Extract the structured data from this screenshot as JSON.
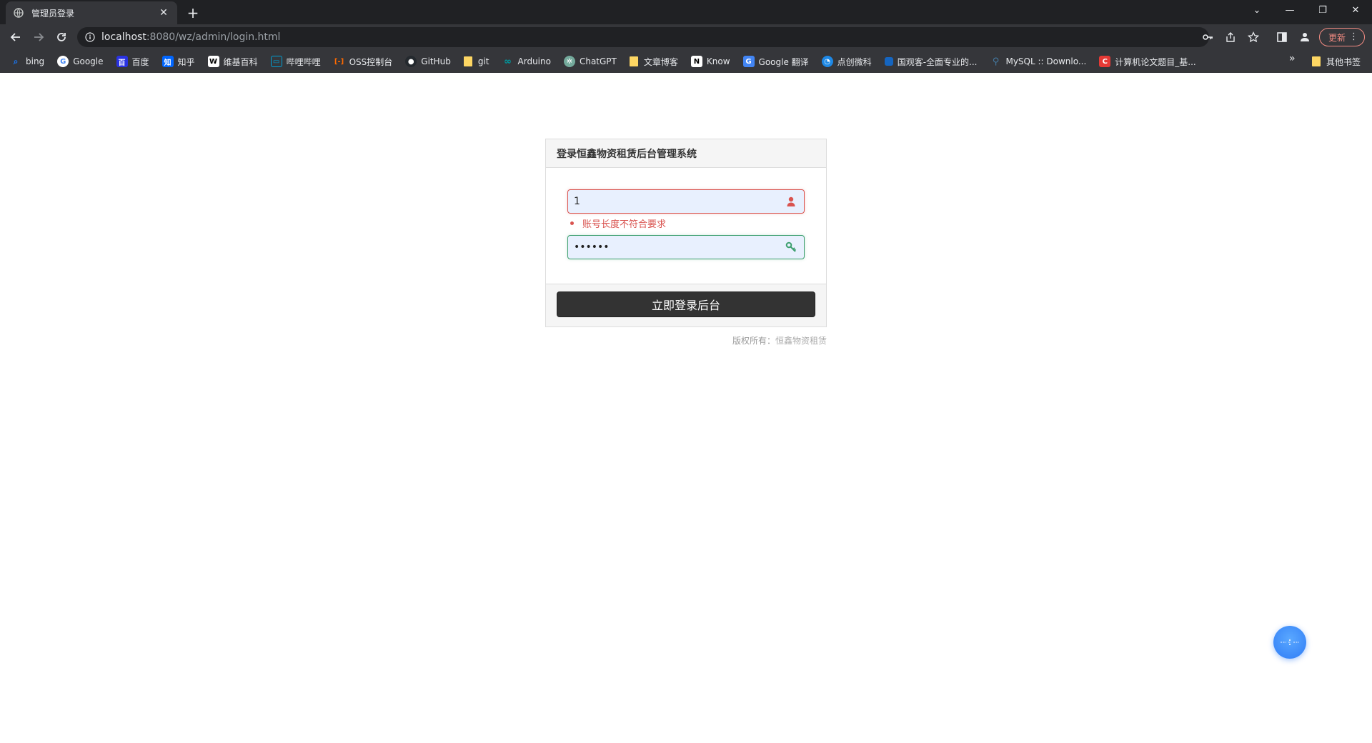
{
  "browser": {
    "tab_title": "管理员登录",
    "url_host": "localhost",
    "url_path": ":8080/wz/admin/login.html",
    "update_label": "更新",
    "bookmarks": [
      {
        "label": "bing",
        "icon": "bing-icon",
        "color": "#1a73e8"
      },
      {
        "label": "Google",
        "icon": "google-icon",
        "color": "#ffffff"
      },
      {
        "label": "百度",
        "icon": "baidu-icon",
        "color": "#2932e1"
      },
      {
        "label": "知乎",
        "icon": "zhihu-icon",
        "color": "#0066ff"
      },
      {
        "label": "维基百科",
        "icon": "wikipedia-icon",
        "color": "#ffffff"
      },
      {
        "label": "哔哩哔哩",
        "icon": "bilibili-icon",
        "color": "#00a1d6"
      },
      {
        "label": "OSS控制台",
        "icon": "aliyun-icon",
        "color": "#ff6a00"
      },
      {
        "label": "GitHub",
        "icon": "github-icon",
        "color": "#24292e"
      },
      {
        "label": "git",
        "icon": "folder-icon",
        "color": "#fdd663"
      },
      {
        "label": "Arduino",
        "icon": "arduino-icon",
        "color": "#00979d"
      },
      {
        "label": "ChatGPT",
        "icon": "chatgpt-icon",
        "color": "#74aa9c"
      },
      {
        "label": "文章博客",
        "icon": "folder-icon",
        "color": "#fdd663"
      },
      {
        "label": "Know",
        "icon": "notion-icon",
        "color": "#ffffff"
      },
      {
        "label": "Google 翻译",
        "icon": "google-translate-icon",
        "color": "#4285f4"
      },
      {
        "label": "点创微科",
        "icon": "dianchuang-icon",
        "color": "#1e88e5"
      },
      {
        "label": "国观客-全面专业的...",
        "icon": "guoguanke-icon",
        "color": "#1565c0"
      },
      {
        "label": "MySQL :: Downlo...",
        "icon": "mysql-icon",
        "color": "#4479a1"
      },
      {
        "label": "计算机论文题目_基...",
        "icon": "c-site-icon",
        "color": "#e53935"
      }
    ],
    "other_bookmarks": "其他书签"
  },
  "login": {
    "heading": "登录恒鑫物资租赁后台管理系统",
    "username_value": "1",
    "username_error": "账号长度不符合要求",
    "password_value": "123456",
    "submit_label": "立即登录后台",
    "copyright_prefix": "版权所有：",
    "copyright_owner": "恒鑫物资租赁"
  },
  "colors": {
    "error": "#d9534f",
    "success": "#3c9f6e",
    "button": "#333333",
    "float_button": "#2f7cf6"
  }
}
